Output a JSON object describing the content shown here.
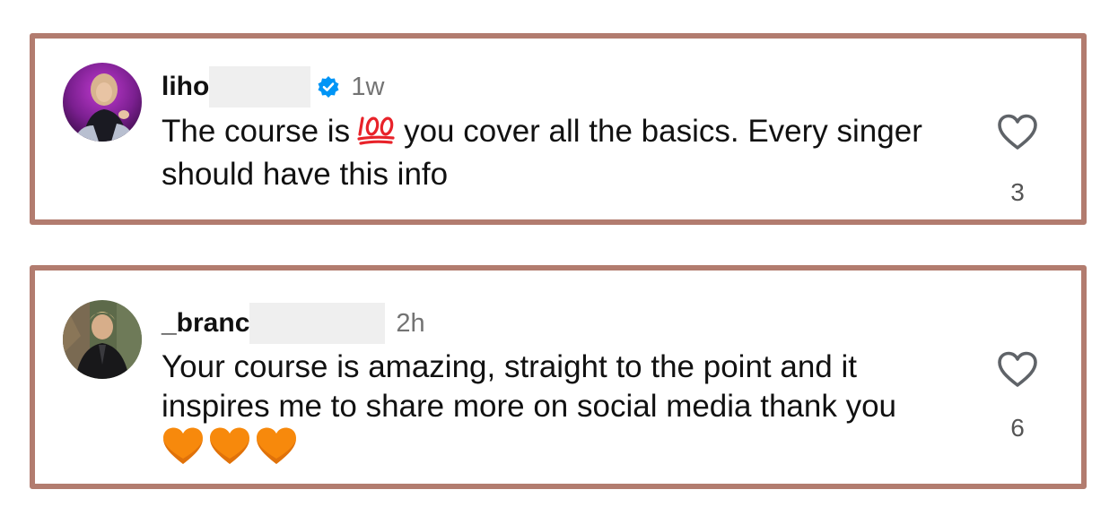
{
  "comments": [
    {
      "username": "liho",
      "verified": true,
      "time": "1w",
      "text_before": "The course is",
      "inline_emoji": "hundred-points-emoji",
      "text_after": "you cover all the basics. Every singer should have this info",
      "likes": "3",
      "like_icon": "heart-outline-icon"
    },
    {
      "username": "_branc",
      "verified": false,
      "time": "2h",
      "text": "Your course is amazing, straight to the point and it inspires me to share more on social media thank you",
      "trailing_emojis": [
        "orange-heart-emoji",
        "orange-heart-emoji",
        "orange-heart-emoji"
      ],
      "likes": "6",
      "like_icon": "heart-outline-icon"
    }
  ],
  "colors": {
    "border": "#b27c6f",
    "verified_badge": "#0095f6",
    "time_text": "#737373",
    "redaction": "#efefef",
    "orange_heart": "#f7890c"
  }
}
